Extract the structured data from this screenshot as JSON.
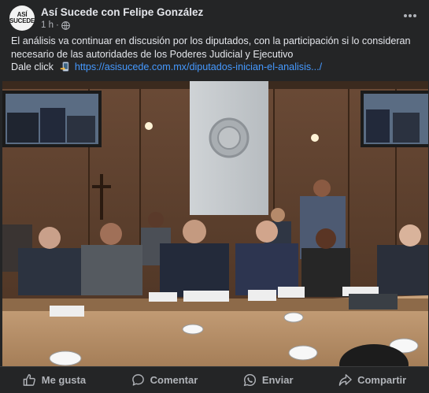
{
  "post": {
    "page_name": "Así Sucede con Felipe González",
    "avatar_text_line1": "ASÍ",
    "avatar_text_line2": "SUCEDE",
    "time": "1 h",
    "separator": "·",
    "text_line1": "El análisis va continuar en discusión por los diputados, con la participación si lo consideran",
    "text_line2": "necesario de las autoridades de los Poderes Judicial y Ejecutivo",
    "link_prefix": "Dale click",
    "link_url": "https://asisucede.com.mx/diputados-inician-el-analisis.../",
    "icons": {
      "globe": "globe-icon",
      "more": "more-options-icon",
      "phone": "mobile-phone-pointing-icon"
    }
  },
  "actions": {
    "like": "Me gusta",
    "comment": "Comentar",
    "share_whatsapp": "Enviar",
    "share": "Compartir"
  },
  "colors": {
    "background": "#242526",
    "text": "#e4e6eb",
    "secondary": "#b0b3b8",
    "link": "#4599ff"
  }
}
